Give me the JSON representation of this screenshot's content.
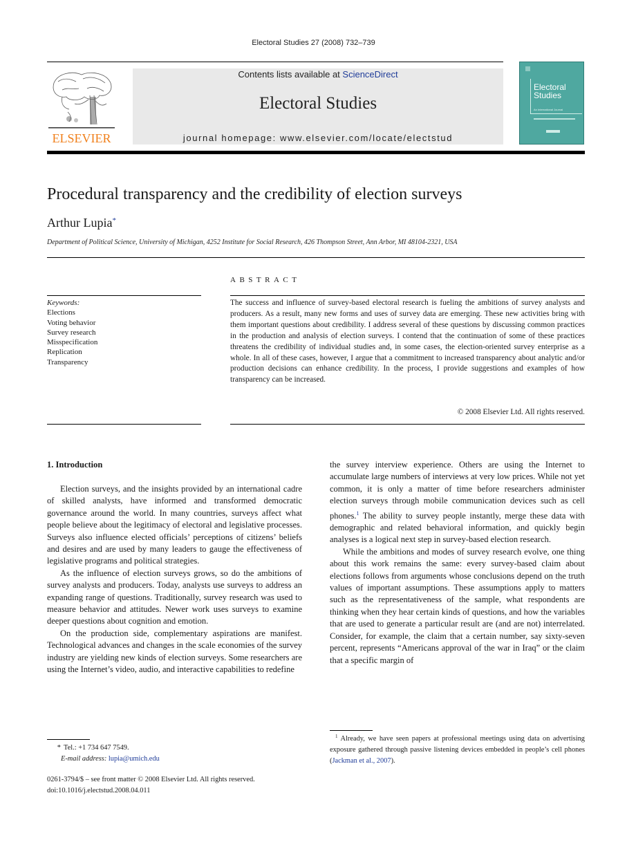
{
  "header": {
    "running_head": "Electoral Studies 27 (2008) 732–739",
    "contents_prefix": "Contents lists available at ",
    "contents_link": "ScienceDirect",
    "journal_title": "Electoral Studies",
    "homepage": "journal homepage: www.elsevier.com/locate/electstud",
    "publisher_logo_text": "ELSEVIER",
    "cover": {
      "title_line1": "Electoral",
      "title_line2": "Studies",
      "subtitle": "An International Journal"
    },
    "colors": {
      "elsevier_orange": "#f07f1a",
      "link_blue": "#1f3c99",
      "masthead_gray": "#e9e9e9",
      "cover_teal": "#4fa8a0"
    }
  },
  "article": {
    "title": "Procedural transparency and the credibility of election surveys",
    "author": "Arthur Lupia",
    "author_mark": "*",
    "affiliation": "Department of Political Science, University of Michigan, 4252 Institute for Social Research, 426 Thompson Street, Ann Arbor, MI 48104-2321, USA"
  },
  "article_info": {
    "keywords_label": "Keywords:",
    "keywords": [
      "Elections",
      "Voting behavior",
      "Survey research",
      "Misspecification",
      "Replication",
      "Transparency"
    ]
  },
  "abstract": {
    "heading": "ABSTRACT",
    "text": "The success and influence of survey-based electoral research is fueling the ambitions of survey analysts and producers. As a result, many new forms and uses of survey data are emerging. These new activities bring with them important questions about credibility. I address several of these questions by discussing common practices in the production and analysis of election surveys. I contend that the continuation of some of these practices threatens the credibility of individual studies and, in some cases, the election-oriented survey enterprise as a whole. In all of these cases, however, I argue that a commitment to increased transparency about analytic and/or production decisions can enhance credi­bility. In the process, I provide suggestions and examples of how transparency can be increased.",
    "copyright": "© 2008 Elsevier Ltd. All rights reserved."
  },
  "body": {
    "section_heading": "1.  Introduction",
    "left_paragraphs": [
      "Election surveys, and the insights provided by an international cadre of skilled analysts, have informed and transformed democratic governance around the world. In many countries, surveys affect what people believe about the legitimacy of electoral and legislative processes. Sur­veys also influence elected officials’ perceptions of citizens’ beliefs and desires and are used by many leaders to gauge the effectiveness of legislative programs and political strategies.",
      "As the influence of election surveys grows, so do the am­bitions of survey analysts and producers. Today, analysts use surveys to address an expanding range of questions. Traditionally, survey research was used to measure behav­ior and attitudes. Newer work uses surveys to examine deeper questions about cognition and emotion.",
      "On the production side, complementary aspirations are manifest. Technological advances and changes in the scale economies of the survey industry are yielding new kinds of election surveys. Some researchers are using the Inter­net’s video, audio, and interactive capabilities to redefine"
    ],
    "right_para1_before_note": "the survey interview experience. Others are using the Internet to accumulate large numbers of interviews at very low prices. While not yet common, it is only a matter of time before researchers administer election surveys through mobile communication devices such as cell phones.",
    "right_para1_note_mark": "1",
    "right_para1_after_note": " The ability to survey people instantly, merge these data with demographic and related behavioral information, and quickly begin analyses is a logical next step in survey-based election research.",
    "right_para2": "While the ambitions and modes of survey research evolve, one thing about this work remains the same: every survey-based claim about elections follows from argu­ments whose conclusions depend on the truth values of important assumptions. These assumptions apply to matters such as the representativeness of the sample, what respondents are thinking when they hear certain kinds of questions, and how the variables that are used to generate a particular result are (and are not) interrelated. Consider, for example, the claim that a certain number, say sixty-seven percent, represents “Americans approval of the war in Iraq” or the claim that a specific margin of"
  },
  "footnotes": {
    "author_mark": "*",
    "tel": "Tel.: +1 734 647 7549.",
    "email_label": "E-mail address:",
    "email": "lupia@umich.edu",
    "front_matter": "0261-3794/$ – see front matter © 2008 Elsevier Ltd. All rights reserved.",
    "doi": "doi:10.1016/j.electstud.2008.04.011",
    "note1_mark": "1",
    "note1_text": "Already, we have seen papers at professional meetings using data on advertising exposure gathered through passive listening devices embed­ded in people’s cell phones (",
    "note1_link": "Jackman et al., 2007",
    "note1_end": ")."
  }
}
